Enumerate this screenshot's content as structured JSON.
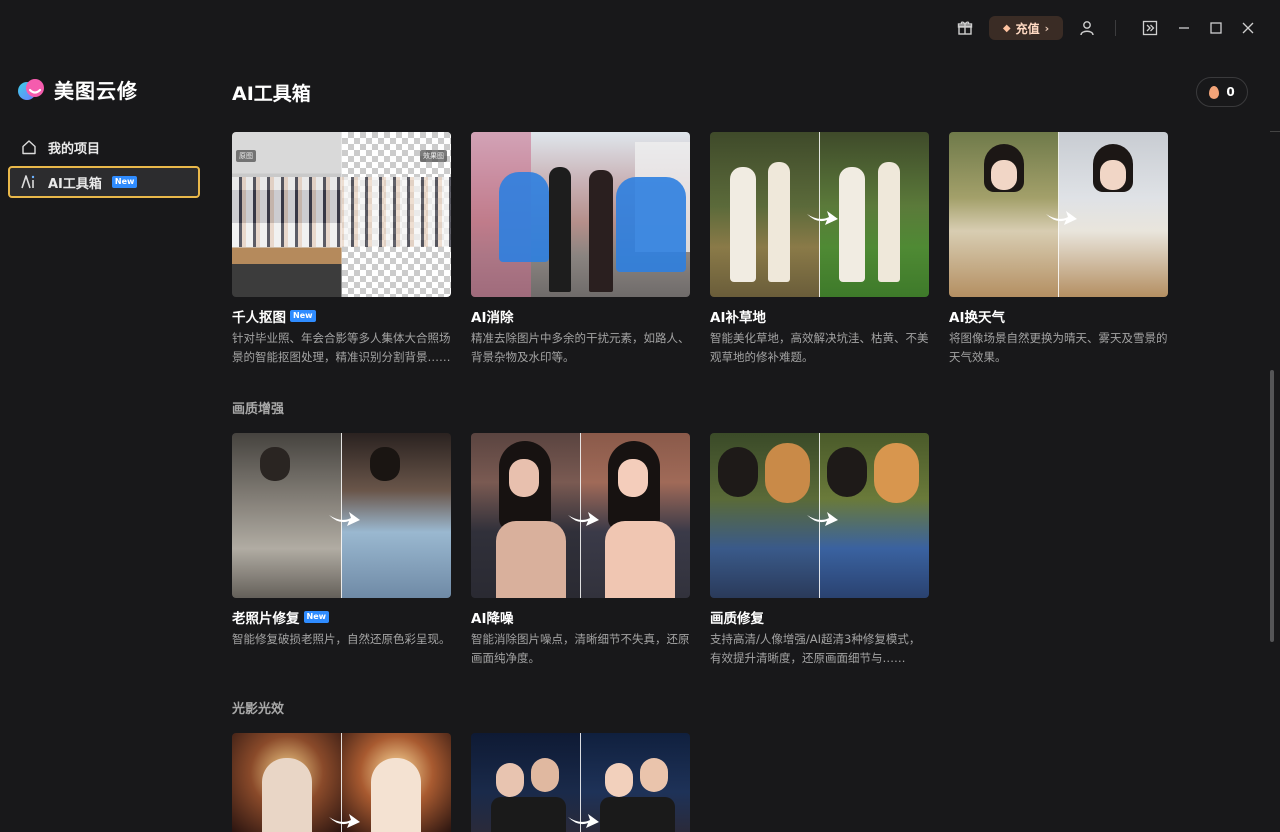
{
  "app": {
    "name": "美图云修"
  },
  "titlebar": {
    "recharge_label": "充值",
    "icons": [
      "gift-icon",
      "user-icon",
      "collapse-panel-icon",
      "minimize-icon",
      "maximize-icon",
      "close-icon"
    ]
  },
  "sidebar": {
    "items": [
      {
        "label": "我的项目",
        "icon": "home-icon"
      },
      {
        "label": "AI工具箱",
        "icon": "ai-toolbox-icon",
        "badge": "New",
        "active": true
      }
    ]
  },
  "main": {
    "title": "AI工具箱",
    "credits": "0",
    "sections": [
      {
        "title": "",
        "cards": [
          {
            "title": "千人抠图",
            "badge": "New",
            "desc": "针对毕业照、年会合影等多人集体大合照场景的智能抠图处理，精准识别分割背景……",
            "tags": [
              "原图",
              "效果图"
            ]
          },
          {
            "title": "AI消除",
            "desc": "精准去除图片中多余的干扰元素，如路人、背景杂物及水印等。"
          },
          {
            "title": "AI补草地",
            "desc": "智能美化草地，高效解决坑洼、枯黄、不美观草地的修补难题。"
          },
          {
            "title": "AI换天气",
            "desc": "将图像场景自然更换为晴天、雾天及雪景的天气效果。"
          }
        ]
      },
      {
        "title": "画质增强",
        "cards": [
          {
            "title": "老照片修复",
            "badge": "New",
            "desc": "智能修复破损老照片，自然还原色彩呈现。"
          },
          {
            "title": "AI降噪",
            "desc": "智能消除图片噪点，清晰细节不失真，还原画面纯净度。"
          },
          {
            "title": "画质修复",
            "desc": "支持高清/人像增强/AI超清3种修复模式，有效提升清晰度，还原画面细节与……"
          }
        ]
      },
      {
        "title": "光影光效",
        "cards": [
          {
            "title": ""
          },
          {
            "title": ""
          }
        ]
      }
    ]
  },
  "colors": {
    "background": "#18181a",
    "accent_border": "#e9b84a",
    "badge_new": "#2f8cff",
    "recharge_bg": "#3a2c25"
  }
}
